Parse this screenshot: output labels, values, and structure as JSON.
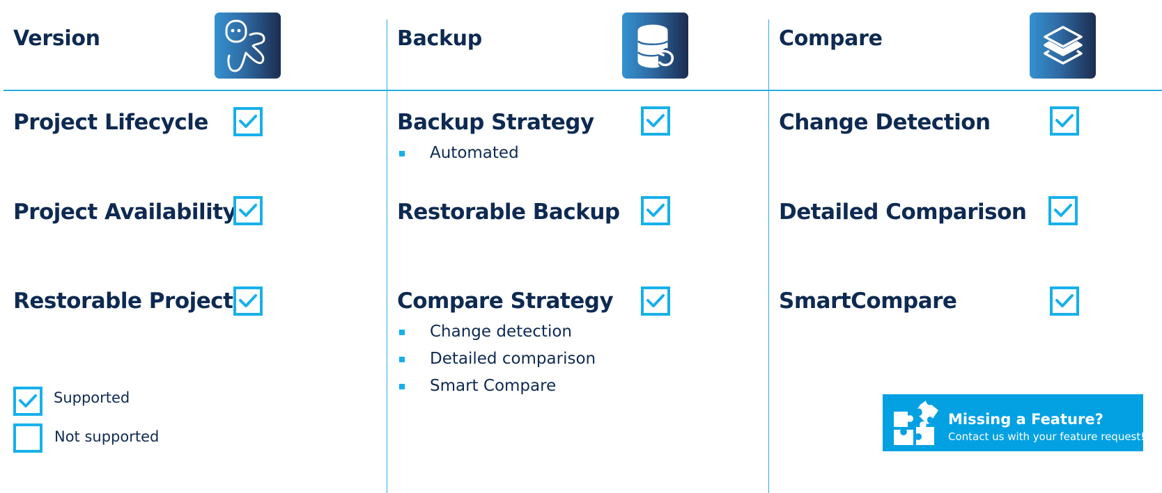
{
  "columns": [
    {
      "title": "Version",
      "icon": "octopus-mascot-icon",
      "features": [
        {
          "label": "Project Lifecycle",
          "supported": true,
          "subitems": []
        },
        {
          "label": "Project Availability",
          "supported": true,
          "subitems": []
        },
        {
          "label": "Restorable Project",
          "supported": true,
          "subitems": []
        }
      ]
    },
    {
      "title": "Backup",
      "icon": "database-restore-icon",
      "features": [
        {
          "label": "Backup Strategy",
          "supported": true,
          "subitems": [
            "Automated"
          ]
        },
        {
          "label": "Restorable Backup",
          "supported": true,
          "subitems": []
        },
        {
          "label": "Compare Strategy",
          "supported": true,
          "subitems": [
            "Change detection",
            "Detailed comparison",
            "Smart Compare"
          ]
        }
      ]
    },
    {
      "title": "Compare",
      "icon": "layers-icon",
      "features": [
        {
          "label": "Change Detection",
          "supported": true,
          "subitems": []
        },
        {
          "label": "Detailed Comparison",
          "supported": true,
          "subitems": []
        },
        {
          "label": "SmartCompare",
          "supported": true,
          "subitems": []
        }
      ]
    }
  ],
  "legend": {
    "supported_label": "Supported",
    "not_supported_label": "Not supported"
  },
  "banner": {
    "icon": "puzzle-pieces-icon",
    "title": "Missing a Feature?",
    "subtitle": "Contact us with your feature request!"
  },
  "colors": {
    "accent": "#16b0ea",
    "divider": "#29aae2",
    "text": "#0e2a52",
    "banner_bg": "#03a1e2",
    "icon_gradient_start": "#3492d0",
    "icon_gradient_end": "#1c2c4f"
  }
}
